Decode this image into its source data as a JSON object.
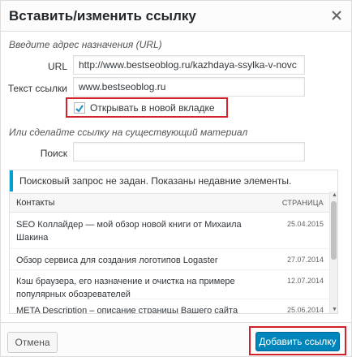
{
  "dialog": {
    "title": "Вставить/изменить ссылку"
  },
  "url_section": {
    "hint": "Введите адрес назначения (URL)",
    "url_label": "URL",
    "url_value": "http://www.bestseoblog.ru/kazhdaya-ssylka-v-novc",
    "link_text_label": "Текст ссылки",
    "link_text_value": "www.bestseoblog.ru",
    "new_tab_label": "Открывать в новой вкладке",
    "new_tab_checked": true
  },
  "search_section": {
    "hint": "Или сделайте ссылку на существующий материал",
    "search_label": "Поиск",
    "search_value": ""
  },
  "results": {
    "notice": "Поисковый запрос не задан. Показаны недавние элементы.",
    "header_title": "Контакты",
    "header_date": "СТРАНИЦА",
    "items": [
      {
        "title": "SEO Коллайдер — мой обзор новой книги от Михаила Шакина",
        "date": "25.04.2015"
      },
      {
        "title": "Обзор сервиса для создания логотипов Logaster",
        "date": "27.07.2014"
      },
      {
        "title": "Кэш браузера, его назначение и очистка на примере популярных обозревателей",
        "date": "12.07.2014"
      },
      {
        "title": "META Description – описание страницы Вашего сайта",
        "date": "25.06.2014"
      }
    ]
  },
  "footer": {
    "cancel_label": "Отмена",
    "submit_label": "Добавить ссылку"
  },
  "colors": {
    "accent": "#0085ba",
    "highlight_box": "#d2232a",
    "notice_border": "#00a0d2"
  }
}
